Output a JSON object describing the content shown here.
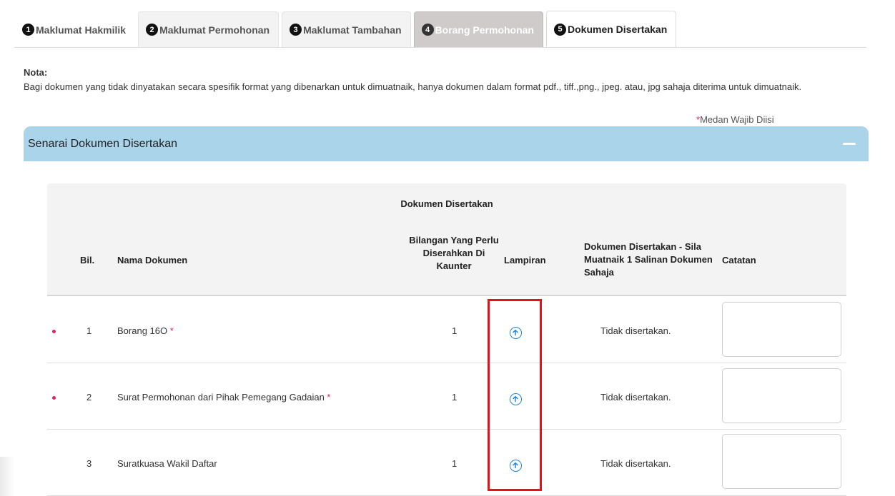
{
  "tabs": [
    {
      "num": "1",
      "label": "Maklumat Hakmilik"
    },
    {
      "num": "2",
      "label": "Maklumat Permohonan"
    },
    {
      "num": "3",
      "label": "Maklumat Tambahan"
    },
    {
      "num": "4",
      "label": "Borang Permohonan"
    },
    {
      "num": "5",
      "label": "Dokumen Disertakan"
    }
  ],
  "nota": {
    "title": "Nota:",
    "text": "Bagi dokumen yang tidak dinyatakan secara spesifik format yang dibenarkan untuk dimuatnaik, hanya dokumen dalam format pdf., tiff.,png., jpeg. atau, jpg sahaja diterima untuk dimuatnaik."
  },
  "mandatory_note": {
    "star": "*",
    "text": "Medan Wajib Diisi"
  },
  "panel": {
    "title": "Senarai Dokumen Disertakan"
  },
  "table": {
    "group_header": "Dokumen Disertakan",
    "columns": {
      "bil": "Bil.",
      "nama": "Nama Dokumen",
      "bilangan": "Bilangan Yang Perlu Diserahkan Di Kaunter",
      "lampiran": "Lampiran",
      "status": "Dokumen Disertakan - Sila Muatnaik 1 Salinan Dokumen Sahaja",
      "catatan": "Catatan"
    },
    "rows": [
      {
        "bil": "1",
        "nama": "Borang 16O",
        "required": "*",
        "bilangan": "1",
        "status": "Tidak disertakan.",
        "catatan": ""
      },
      {
        "bil": "2",
        "nama": "Surat Permohonan dari Pihak Pemegang Gadaian",
        "required": "*",
        "bilangan": "1",
        "status": "Tidak disertakan.",
        "catatan": ""
      },
      {
        "bil": "3",
        "nama": "Suratkuasa Wakil Daftar",
        "required": "",
        "bilangan": "1",
        "status": "Tidak disertakan.",
        "catatan": ""
      }
    ]
  },
  "colors": {
    "accent": "#a9d4ea",
    "required": "#e0245e",
    "upload": "#1f86e0",
    "highlight": "#e1141b"
  }
}
